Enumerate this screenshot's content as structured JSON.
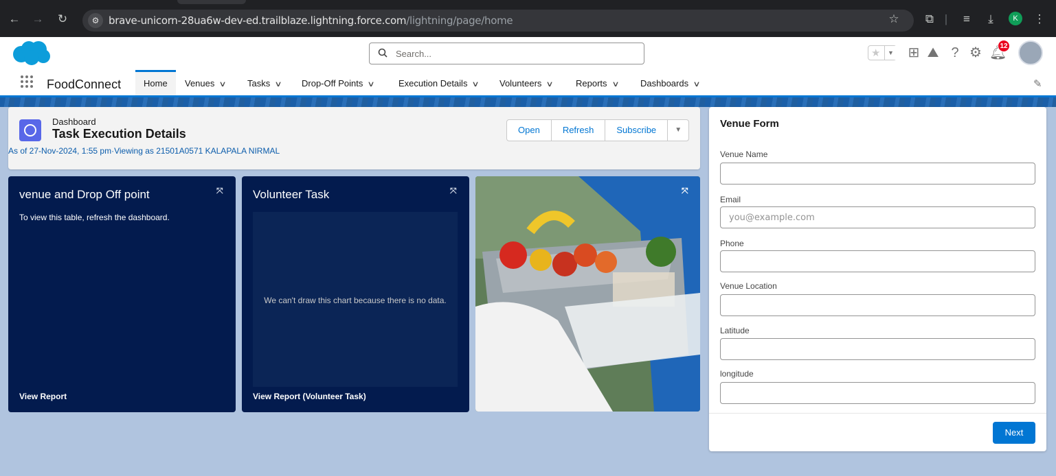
{
  "browser": {
    "url_host": "brave-unicorn-28ua6w-dev-ed.trailblaze.lightning.force.com",
    "url_path": "/lightning/page/home",
    "profile_initial": "K"
  },
  "header": {
    "search_placeholder": "Search...",
    "notification_count": "12"
  },
  "nav": {
    "app_name": "FoodConnect",
    "items": [
      {
        "label": "Home"
      },
      {
        "label": "Venues"
      },
      {
        "label": "Tasks"
      },
      {
        "label": "Drop-Off Points"
      },
      {
        "label": "Execution Details"
      },
      {
        "label": "Volunteers"
      },
      {
        "label": "Reports"
      },
      {
        "label": "Dashboards"
      }
    ]
  },
  "dashboard": {
    "type_label": "Dashboard",
    "title": "Task Execution Details",
    "as_of": "As of 27-Nov-2024, 1:55 pm·Viewing as 21501A0571 KALAPALA NIRMAL",
    "buttons": {
      "open": "Open",
      "refresh": "Refresh",
      "subscribe": "Subscribe"
    },
    "panels": [
      {
        "title": "venue and Drop Off point",
        "message": "To view this table, refresh the dashboard.",
        "footer": "View Report"
      },
      {
        "title": "Volunteer Task",
        "message": "We can't draw this chart because there is no data.",
        "footer": "View Report (Volunteer Task)"
      }
    ]
  },
  "venue_form": {
    "title": "Venue Form",
    "fields": [
      {
        "label": "Venue Name",
        "placeholder": ""
      },
      {
        "label": "Email",
        "placeholder": "you@example.com"
      },
      {
        "label": "Phone",
        "placeholder": ""
      },
      {
        "label": "Venue Location",
        "placeholder": ""
      },
      {
        "label": "Latitude",
        "placeholder": ""
      },
      {
        "label": "longitude",
        "placeholder": ""
      }
    ],
    "next_label": "Next"
  },
  "colors": {
    "brand": "#0176d3",
    "panel_bg": "#031b4e",
    "page_bg": "#b0c4df"
  }
}
